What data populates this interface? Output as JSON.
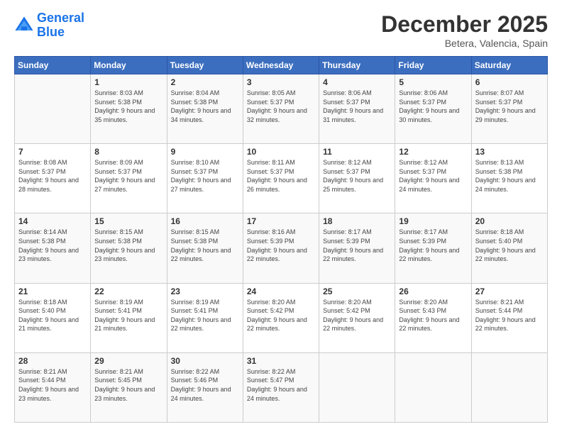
{
  "header": {
    "logo_line1": "General",
    "logo_line2": "Blue",
    "title": "December 2025",
    "subtitle": "Betera, Valencia, Spain"
  },
  "calendar": {
    "days_of_week": [
      "Sunday",
      "Monday",
      "Tuesday",
      "Wednesday",
      "Thursday",
      "Friday",
      "Saturday"
    ],
    "weeks": [
      [
        {
          "day": "",
          "sunrise": "",
          "sunset": "",
          "daylight": ""
        },
        {
          "day": "1",
          "sunrise": "8:03 AM",
          "sunset": "5:38 PM",
          "daylight": "9 hours and 35 minutes."
        },
        {
          "day": "2",
          "sunrise": "8:04 AM",
          "sunset": "5:38 PM",
          "daylight": "9 hours and 34 minutes."
        },
        {
          "day": "3",
          "sunrise": "8:05 AM",
          "sunset": "5:37 PM",
          "daylight": "9 hours and 32 minutes."
        },
        {
          "day": "4",
          "sunrise": "8:06 AM",
          "sunset": "5:37 PM",
          "daylight": "9 hours and 31 minutes."
        },
        {
          "day": "5",
          "sunrise": "8:06 AM",
          "sunset": "5:37 PM",
          "daylight": "9 hours and 30 minutes."
        },
        {
          "day": "6",
          "sunrise": "8:07 AM",
          "sunset": "5:37 PM",
          "daylight": "9 hours and 29 minutes."
        }
      ],
      [
        {
          "day": "7",
          "sunrise": "8:08 AM",
          "sunset": "5:37 PM",
          "daylight": "9 hours and 28 minutes."
        },
        {
          "day": "8",
          "sunrise": "8:09 AM",
          "sunset": "5:37 PM",
          "daylight": "9 hours and 27 minutes."
        },
        {
          "day": "9",
          "sunrise": "8:10 AM",
          "sunset": "5:37 PM",
          "daylight": "9 hours and 27 minutes."
        },
        {
          "day": "10",
          "sunrise": "8:11 AM",
          "sunset": "5:37 PM",
          "daylight": "9 hours and 26 minutes."
        },
        {
          "day": "11",
          "sunrise": "8:12 AM",
          "sunset": "5:37 PM",
          "daylight": "9 hours and 25 minutes."
        },
        {
          "day": "12",
          "sunrise": "8:12 AM",
          "sunset": "5:37 PM",
          "daylight": "9 hours and 24 minutes."
        },
        {
          "day": "13",
          "sunrise": "8:13 AM",
          "sunset": "5:38 PM",
          "daylight": "9 hours and 24 minutes."
        }
      ],
      [
        {
          "day": "14",
          "sunrise": "8:14 AM",
          "sunset": "5:38 PM",
          "daylight": "9 hours and 23 minutes."
        },
        {
          "day": "15",
          "sunrise": "8:15 AM",
          "sunset": "5:38 PM",
          "daylight": "9 hours and 23 minutes."
        },
        {
          "day": "16",
          "sunrise": "8:15 AM",
          "sunset": "5:38 PM",
          "daylight": "9 hours and 22 minutes."
        },
        {
          "day": "17",
          "sunrise": "8:16 AM",
          "sunset": "5:39 PM",
          "daylight": "9 hours and 22 minutes."
        },
        {
          "day": "18",
          "sunrise": "8:17 AM",
          "sunset": "5:39 PM",
          "daylight": "9 hours and 22 minutes."
        },
        {
          "day": "19",
          "sunrise": "8:17 AM",
          "sunset": "5:39 PM",
          "daylight": "9 hours and 22 minutes."
        },
        {
          "day": "20",
          "sunrise": "8:18 AM",
          "sunset": "5:40 PM",
          "daylight": "9 hours and 22 minutes."
        }
      ],
      [
        {
          "day": "21",
          "sunrise": "8:18 AM",
          "sunset": "5:40 PM",
          "daylight": "9 hours and 21 minutes."
        },
        {
          "day": "22",
          "sunrise": "8:19 AM",
          "sunset": "5:41 PM",
          "daylight": "9 hours and 21 minutes."
        },
        {
          "day": "23",
          "sunrise": "8:19 AM",
          "sunset": "5:41 PM",
          "daylight": "9 hours and 22 minutes."
        },
        {
          "day": "24",
          "sunrise": "8:20 AM",
          "sunset": "5:42 PM",
          "daylight": "9 hours and 22 minutes."
        },
        {
          "day": "25",
          "sunrise": "8:20 AM",
          "sunset": "5:42 PM",
          "daylight": "9 hours and 22 minutes."
        },
        {
          "day": "26",
          "sunrise": "8:20 AM",
          "sunset": "5:43 PM",
          "daylight": "9 hours and 22 minutes."
        },
        {
          "day": "27",
          "sunrise": "8:21 AM",
          "sunset": "5:44 PM",
          "daylight": "9 hours and 22 minutes."
        }
      ],
      [
        {
          "day": "28",
          "sunrise": "8:21 AM",
          "sunset": "5:44 PM",
          "daylight": "9 hours and 23 minutes."
        },
        {
          "day": "29",
          "sunrise": "8:21 AM",
          "sunset": "5:45 PM",
          "daylight": "9 hours and 23 minutes."
        },
        {
          "day": "30",
          "sunrise": "8:22 AM",
          "sunset": "5:46 PM",
          "daylight": "9 hours and 24 minutes."
        },
        {
          "day": "31",
          "sunrise": "8:22 AM",
          "sunset": "5:47 PM",
          "daylight": "9 hours and 24 minutes."
        },
        {
          "day": "",
          "sunrise": "",
          "sunset": "",
          "daylight": ""
        },
        {
          "day": "",
          "sunrise": "",
          "sunset": "",
          "daylight": ""
        },
        {
          "day": "",
          "sunrise": "",
          "sunset": "",
          "daylight": ""
        }
      ]
    ]
  }
}
